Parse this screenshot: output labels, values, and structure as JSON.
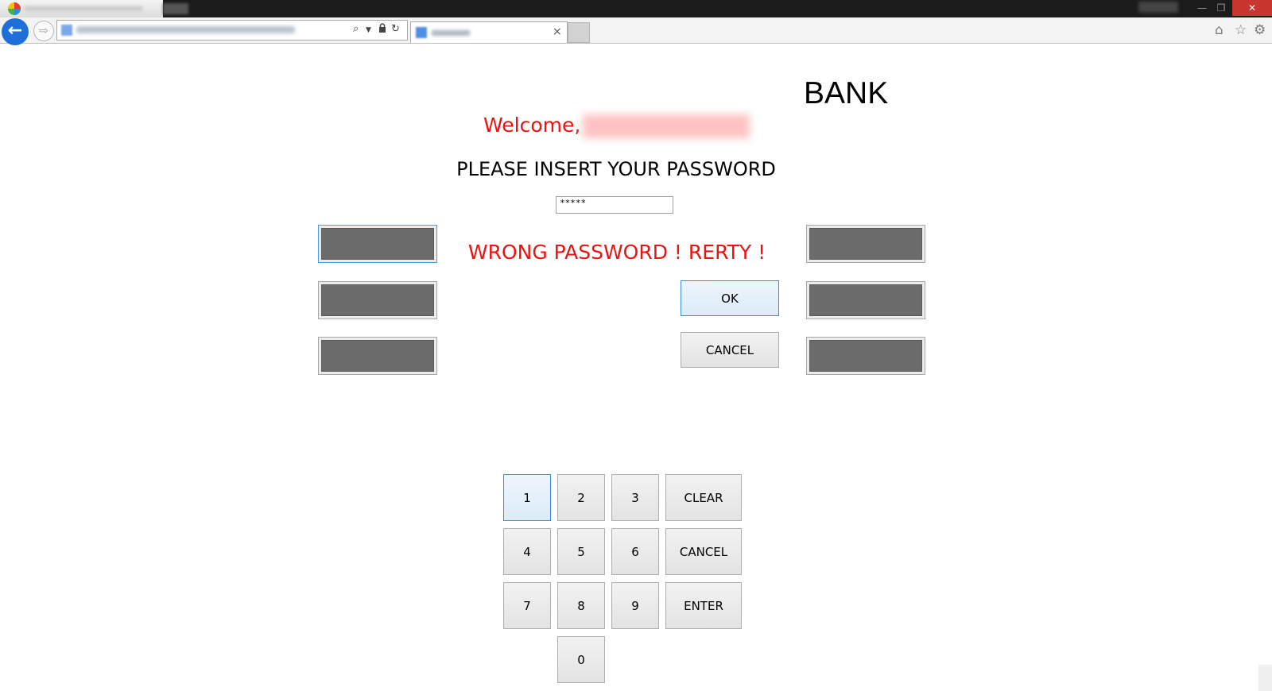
{
  "window": {
    "min_glyph": "—",
    "max_glyph": "❐",
    "close_glyph": "✕"
  },
  "browser": {
    "back_glyph": "←",
    "forward_glyph": "⇨",
    "tab_close_glyph": "×",
    "address_icons": [
      "search-icon",
      "dropdown-icon",
      "lock-icon",
      "refresh-icon"
    ],
    "toolbar_icons": [
      "home-icon",
      "star-icon",
      "gear-icon"
    ]
  },
  "bank": {
    "title": "BANK",
    "welcome_label": "Welcome,",
    "prompt": "PLEASE INSERT YOUR PASSWORD",
    "password_value": "*****",
    "error_message": "WRONG PASSWORD ! RERTY !",
    "ok_label": "OK",
    "cancel_label": "CANCEL"
  },
  "keypad": {
    "keys": {
      "k1": "1",
      "k2": "2",
      "k3": "3",
      "k4": "4",
      "k5": "5",
      "k6": "6",
      "k7": "7",
      "k8": "8",
      "k9": "9",
      "k0": "0",
      "clear": "CLEAR",
      "cancel": "CANCEL",
      "enter": "ENTER"
    }
  },
  "colors": {
    "error_red": "#ee1111",
    "side_button_fill": "#6c6c6c",
    "focus_blue": "#3c8ae0",
    "back_button_blue": "#1e6fd9",
    "close_button_red": "#c7372f"
  }
}
